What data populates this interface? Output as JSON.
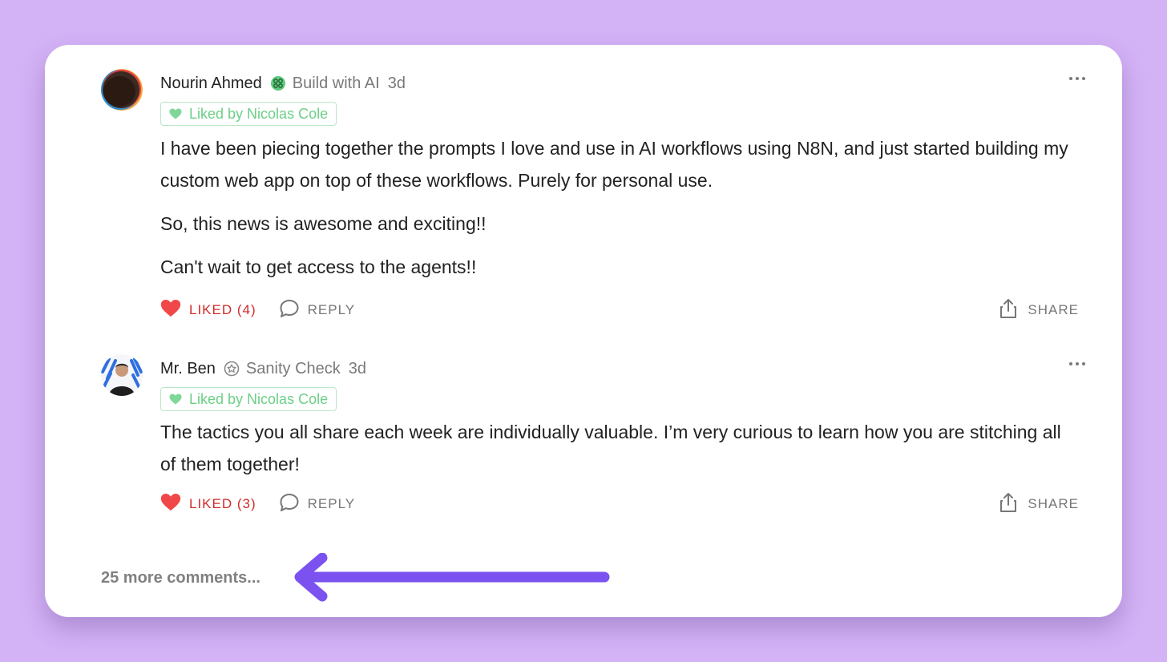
{
  "comments": [
    {
      "author": "Nourin Ahmed",
      "community": "Build with AI",
      "time": "3d",
      "liked_by": "Liked by Nicolas Cole",
      "paragraphs": [
        "I have been piecing together the prompts I love and use in AI workflows using N8N, and just started building my custom web app on top of these workflows. Purely for personal use.",
        "So, this news is awesome and exciting!!",
        "Can't wait to get access to the agents!!"
      ],
      "like_label": "LIKED (4)",
      "reply_label": "REPLY",
      "share_label": "SHARE"
    },
    {
      "author": "Mr. Ben",
      "community": "Sanity Check",
      "time": "3d",
      "liked_by": "Liked by Nicolas Cole",
      "paragraphs": [
        "The tactics you all share each week are individually valuable. I’m very curious to learn how you are stitching all of them together!"
      ],
      "like_label": "LIKED (3)",
      "reply_label": "REPLY",
      "share_label": "SHARE"
    }
  ],
  "more_comments": "25 more comments...",
  "colors": {
    "background": "#d4b2f6",
    "liked": "#d22b2b",
    "liked_heart": "#f04848",
    "liked_by_green": "#6ccf86",
    "arrow": "#7b52f0"
  }
}
